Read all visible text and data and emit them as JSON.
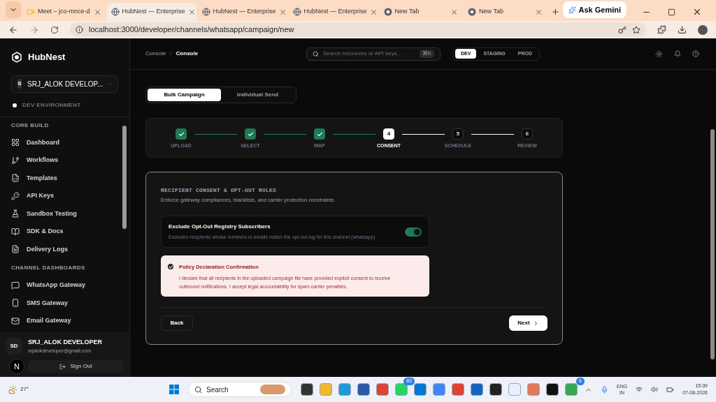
{
  "browser": {
    "tabs": [
      {
        "title": "Meet – jco-mnce-d",
        "kind": "meet",
        "selected": false
      },
      {
        "title": "HubNest — Enterprise",
        "kind": "page",
        "selected": true
      },
      {
        "title": "HubNest — Enterprise",
        "kind": "page",
        "selected": false
      },
      {
        "title": "HubNest — Enterprise",
        "kind": "page",
        "selected": false
      },
      {
        "title": "New Tab",
        "kind": "newtab",
        "selected": false
      },
      {
        "title": "New Tab",
        "kind": "newtab",
        "selected": false
      }
    ],
    "ask_gemini": "Ask Gemini",
    "url": "localhost:3000/developer/channels/whatsapp/campaign/new"
  },
  "sidebar": {
    "brand": "HubNest",
    "workspace": {
      "initial": "S",
      "name": "SRJ_ALOK DEVELOP..."
    },
    "environment": "DEV ENVIRONMENT",
    "sections": [
      {
        "title": "CORE BUILD",
        "items": [
          {
            "label": "Dashboard"
          },
          {
            "label": "Workflows"
          },
          {
            "label": "Templates"
          },
          {
            "label": "API Keys"
          },
          {
            "label": "Sandbox Testing"
          },
          {
            "label": "SDK & Docs"
          },
          {
            "label": "Delivery Logs"
          }
        ]
      },
      {
        "title": "CHANNEL DASHBOARDS",
        "items": [
          {
            "label": "WhatsApp Gateway"
          },
          {
            "label": "SMS Gateway"
          },
          {
            "label": "Email Gateway"
          }
        ]
      }
    ],
    "user": {
      "initials": "SD",
      "name": "SRJ_ALOK DEVELOPER",
      "email": "srjalokdeveloper@gmail.com",
      "indicator": "N"
    },
    "sign_out": "Sign Out"
  },
  "header": {
    "breadcrumb": [
      "Console",
      "Console"
    ],
    "separator": "/",
    "search": {
      "placeholder": "Search resources or API keys...",
      "shortcut": "⌘K"
    },
    "environments": [
      {
        "label": "DEV",
        "selected": true
      },
      {
        "label": "STAGING",
        "selected": false
      },
      {
        "label": "PROD",
        "selected": false
      }
    ]
  },
  "mode_tabs": [
    {
      "label": "Bulk Campaign",
      "selected": true
    },
    {
      "label": "Individual Send",
      "selected": false
    }
  ],
  "steps": [
    {
      "label": "UPLOAD",
      "completed": true,
      "selected": false
    },
    {
      "label": "SELECT",
      "completed": true,
      "selected": false
    },
    {
      "label": "MAP",
      "completed": true,
      "selected": false
    },
    {
      "number": "4",
      "label": "CONSENT",
      "completed": false,
      "selected": true
    },
    {
      "number": "5",
      "label": "SCHEDULE",
      "completed": false,
      "selected": false
    },
    {
      "number": "6",
      "label": "REVIEW",
      "completed": false,
      "selected": false
    }
  ],
  "panel": {
    "title": "RECIPIENT CONSENT & OPT-OUT RULES",
    "subtitle": "Enforce gateway compliances, blacklists, and carrier protection constraints.",
    "toggle": {
      "title": "Exclude Opt-Out Registry Subscribers",
      "description": "Excludes recipients whose numbers or emails match the opt-out log for this channel (whatsapp)",
      "on": true
    },
    "declaration": {
      "title": "Policy Declaration Confirmation",
      "text": "I declare that all recipients in the uploaded campaign file have provided explicit consent to receive outbound notifications. I accept legal accountability for spam carrier penalties.",
      "checked": true
    },
    "back": "Back",
    "next": "Next"
  },
  "taskbar": {
    "weather": "27°",
    "search": "Search",
    "whatsapp_badge": "83",
    "chrome_badge": "6",
    "language": [
      "ENG",
      "IN"
    ],
    "time": "15:39",
    "date": "07-08-2026"
  }
}
